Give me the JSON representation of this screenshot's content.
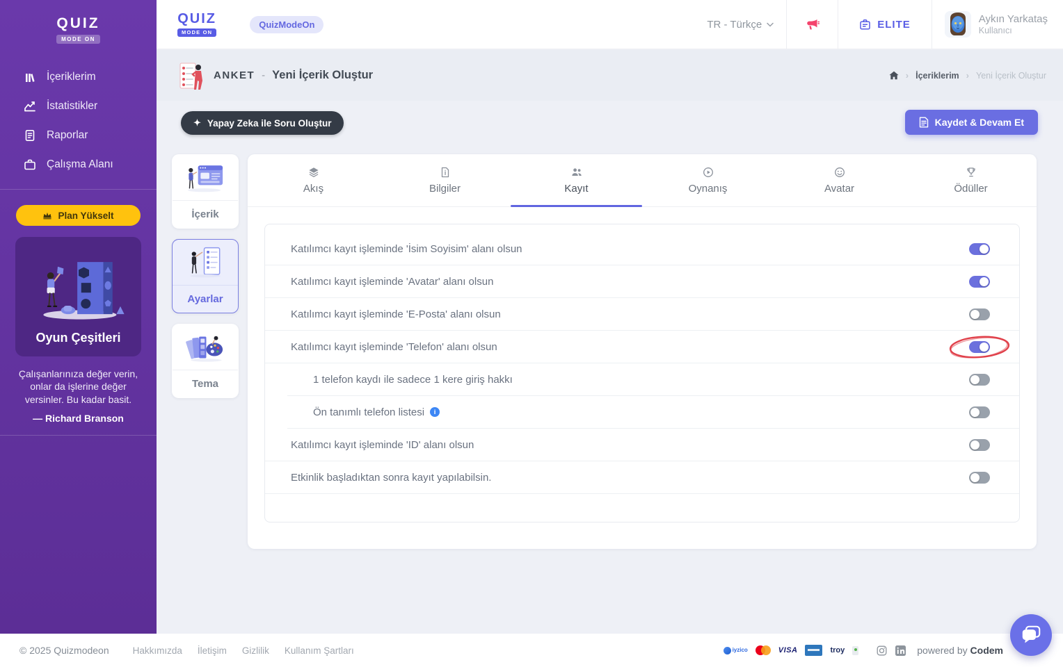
{
  "sidebar": {
    "logo_line1": "QUIZ",
    "logo_line2": "MODE ON",
    "items": [
      {
        "label": "İçeriklerim",
        "icon": "library-icon"
      },
      {
        "label": "İstatistikler",
        "icon": "chart-icon"
      },
      {
        "label": "Raporlar",
        "icon": "report-icon"
      },
      {
        "label": "Çalışma Alanı",
        "icon": "briefcase-icon"
      }
    ],
    "upgrade_label": "Plan Yükselt",
    "promo_card_label": "Oyun Çeşitleri",
    "quote": "Çalışanlarınıza değer verin, onlar da işlerine değer versinler. Bu kadar basit.",
    "quote_author": "— Richard Branson"
  },
  "header": {
    "logo_line1": "QUIZ",
    "logo_line2": "MODE ON",
    "workspace_badge": "QuizModeOn",
    "language": "TR - Türkçe",
    "plan_badge": "ELITE",
    "user_name": "Aykın Yarkataş",
    "user_role": "Kullanıcı"
  },
  "breadcrumb_bar": {
    "content_type": "ANKET",
    "separator": "-",
    "page_title": "Yeni İçerik Oluştur",
    "crumbs": [
      "İçeriklerim",
      "Yeni İçerik Oluştur"
    ]
  },
  "actions": {
    "ai_button": "Yapay Zeka ile Soru Oluştur",
    "save_button": "Kaydet & Devam Et"
  },
  "steps": [
    {
      "label": "İçerik",
      "active": false
    },
    {
      "label": "Ayarlar",
      "active": true
    },
    {
      "label": "Tema",
      "active": false
    }
  ],
  "tabs": [
    {
      "label": "Akış",
      "icon": "layers-icon",
      "active": false
    },
    {
      "label": "Bilgiler",
      "icon": "file-info-icon",
      "active": false
    },
    {
      "label": "Kayıt",
      "icon": "users-icon",
      "active": true
    },
    {
      "label": "Oynanış",
      "icon": "play-circle-icon",
      "active": false
    },
    {
      "label": "Avatar",
      "icon": "smiley-icon",
      "active": false
    },
    {
      "label": "Ödüller",
      "icon": "trophy-icon",
      "active": false
    }
  ],
  "settings": [
    {
      "label": "Katılımcı kayıt işleminde 'İsim Soyisim' alanı olsun",
      "on": true,
      "indent": false,
      "info": false,
      "highlighted": false
    },
    {
      "label": "Katılımcı kayıt işleminde 'Avatar' alanı olsun",
      "on": true,
      "indent": false,
      "info": false,
      "highlighted": false
    },
    {
      "label": "Katılımcı kayıt işleminde 'E-Posta' alanı olsun",
      "on": false,
      "indent": false,
      "info": false,
      "highlighted": false
    },
    {
      "label": "Katılımcı kayıt işleminde 'Telefon' alanı olsun",
      "on": true,
      "indent": false,
      "info": false,
      "highlighted": true
    },
    {
      "label": "1 telefon kaydı ile sadece 1 kere giriş hakkı",
      "on": false,
      "indent": true,
      "info": false,
      "highlighted": false
    },
    {
      "label": "Ön tanımlı telefon listesi",
      "on": false,
      "indent": true,
      "info": true,
      "highlighted": false
    },
    {
      "label": "Katılımcı kayıt işleminde 'ID' alanı olsun",
      "on": false,
      "indent": false,
      "info": false,
      "highlighted": false
    },
    {
      "label": "Etkinlik başladıktan sonra kayıt yapılabilsin.",
      "on": false,
      "indent": false,
      "info": false,
      "highlighted": false
    }
  ],
  "footer": {
    "copyright": "© 2025 Quizmodeon",
    "links": [
      "Hakkımızda",
      "İletişim",
      "Gizlilik",
      "Kullanım Şartları"
    ],
    "payments": [
      "iyzico",
      "mastercard",
      "VISA",
      "amex",
      "troy"
    ],
    "powered_by": "powered by ",
    "powered_brand": "Codem"
  },
  "colors": {
    "accent": "#6065e0",
    "sidebar_purple": "#6133a2",
    "toggle_on": "#6b70dd",
    "toggle_off": "#99a1ab",
    "upgrade_yellow": "#ffc20e",
    "megaphone_red": "#f4436c",
    "highlight_red": "#e0404a"
  }
}
